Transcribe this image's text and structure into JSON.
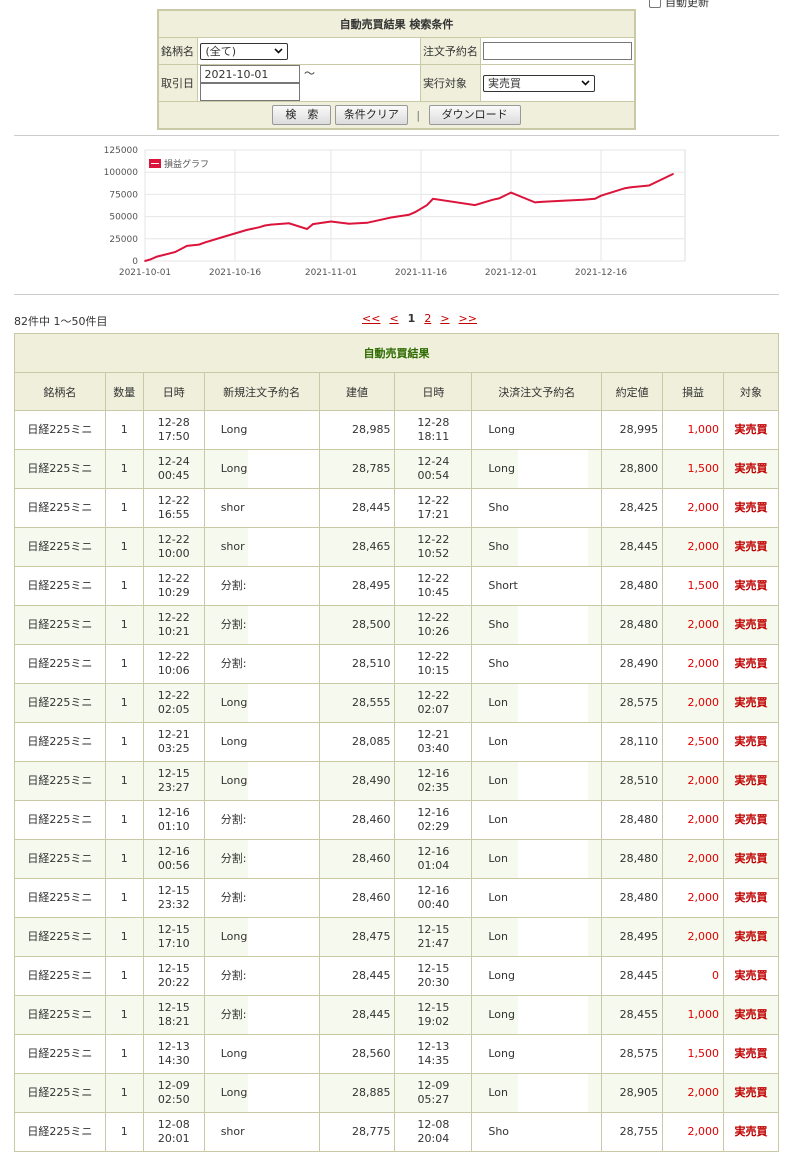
{
  "auto_refresh_label": "自動更新",
  "search": {
    "title": "自動売買結果 検索条件",
    "symbol_label": "銘柄名",
    "symbol_value": "(全て)",
    "order_name_label": "注文予約名",
    "order_name_value": "",
    "date_label": "取引日",
    "date_from": "2021-10-01",
    "date_sep": "〜",
    "date_to": "",
    "target_label": "実行対象",
    "target_value": "実売買",
    "search_button": "検　索",
    "clear_button": "条件クリア",
    "separator": "|",
    "download_button": "ダウンロード"
  },
  "chart_data": {
    "type": "line",
    "title": "",
    "legend": [
      "損益グラフ"
    ],
    "legend_position": "top-left",
    "grid": true,
    "xlabel": "",
    "ylabel": "",
    "ylim": [
      0,
      125000
    ],
    "yticks": [
      "125000",
      "100000",
      "75000",
      "50000",
      "25000",
      "0"
    ],
    "xticks": [
      "2021-10-01",
      "2021-10-16",
      "2021-11-01",
      "2021-11-16",
      "2021-12-01",
      "2021-12-16"
    ],
    "x": [
      "2021-10-01",
      "2021-10-02",
      "2021-10-03",
      "2021-10-06",
      "2021-10-08",
      "2021-10-10",
      "2021-10-11",
      "2021-10-14",
      "2021-10-18",
      "2021-10-20",
      "2021-10-21",
      "2021-10-22",
      "2021-10-25",
      "2021-10-28",
      "2021-10-29",
      "2021-10-31",
      "2021-11-01",
      "2021-11-04",
      "2021-11-07",
      "2021-11-09",
      "2021-11-11",
      "2021-11-14",
      "2021-11-15",
      "2021-11-17",
      "2021-11-18",
      "2021-11-25",
      "2021-11-28",
      "2021-11-29",
      "2021-12-01",
      "2021-12-05",
      "2021-12-06",
      "2021-12-10",
      "2021-12-13",
      "2021-12-15",
      "2021-12-16",
      "2021-12-20",
      "2021-12-21",
      "2021-12-24",
      "2021-12-28"
    ],
    "series": [
      {
        "name": "損益グラフ",
        "color": "#dc143c",
        "values": [
          0,
          2000,
          5000,
          10000,
          17000,
          18500,
          21000,
          27000,
          35000,
          38000,
          40000,
          41000,
          42500,
          36000,
          41500,
          43500,
          44500,
          42000,
          43000,
          46000,
          49000,
          52000,
          55000,
          63000,
          70000,
          63000,
          69000,
          70500,
          77000,
          66000,
          66500,
          68000,
          69000,
          70000,
          73500,
          82000,
          83000,
          85000,
          98000
        ]
      }
    ]
  },
  "count_text": "82件中 1〜50件目",
  "pager": {
    "first": "<<",
    "prev": "<",
    "p1": "1",
    "p2": "2",
    "next": ">",
    "last": ">>"
  },
  "results": {
    "title": "自動売買結果",
    "headers": [
      "銘柄名",
      "数量",
      "日時",
      "新規注文予約名",
      "建値",
      "日時",
      "決済注文予約名",
      "約定値",
      "損益",
      "対象"
    ],
    "rows": [
      {
        "sym": "日経225ミニ",
        "qty": "1",
        "d1": "12-28",
        "t1": "17:50",
        "n1": "Long",
        "p1": "28,985",
        "d2": "12-28",
        "t2": "18:11",
        "n2": "Long",
        "p2": "28,995",
        "pl": "1,000",
        "tg": "実売買"
      },
      {
        "sym": "日経225ミニ",
        "qty": "1",
        "d1": "12-24",
        "t1": "00:45",
        "n1": "Long",
        "p1": "28,785",
        "d2": "12-24",
        "t2": "00:54",
        "n2": "Long",
        "p2": "28,800",
        "pl": "1,500",
        "tg": "実売買"
      },
      {
        "sym": "日経225ミニ",
        "qty": "1",
        "d1": "12-22",
        "t1": "16:55",
        "n1": "shor",
        "p1": "28,445",
        "d2": "12-22",
        "t2": "17:21",
        "n2": "Sho",
        "p2": "28,425",
        "pl": "2,000",
        "tg": "実売買"
      },
      {
        "sym": "日経225ミニ",
        "qty": "1",
        "d1": "12-22",
        "t1": "10:00",
        "n1": "shor",
        "p1": "28,465",
        "d2": "12-22",
        "t2": "10:52",
        "n2": "Sho",
        "p2": "28,445",
        "pl": "2,000",
        "tg": "実売買"
      },
      {
        "sym": "日経225ミニ",
        "qty": "1",
        "d1": "12-22",
        "t1": "10:29",
        "n1": "分割:",
        "p1": "28,495",
        "d2": "12-22",
        "t2": "10:45",
        "n2": "Short",
        "p2": "28,480",
        "pl": "1,500",
        "tg": "実売買"
      },
      {
        "sym": "日経225ミニ",
        "qty": "1",
        "d1": "12-22",
        "t1": "10:21",
        "n1": "分割:",
        "p1": "28,500",
        "d2": "12-22",
        "t2": "10:26",
        "n2": "Sho",
        "p2": "28,480",
        "pl": "2,000",
        "tg": "実売買"
      },
      {
        "sym": "日経225ミニ",
        "qty": "1",
        "d1": "12-22",
        "t1": "10:06",
        "n1": "分割:",
        "p1": "28,510",
        "d2": "12-22",
        "t2": "10:15",
        "n2": "Sho",
        "p2": "28,490",
        "pl": "2,000",
        "tg": "実売買"
      },
      {
        "sym": "日経225ミニ",
        "qty": "1",
        "d1": "12-22",
        "t1": "02:05",
        "n1": "Long",
        "p1": "28,555",
        "d2": "12-22",
        "t2": "02:07",
        "n2": "Lon",
        "p2": "28,575",
        "pl": "2,000",
        "tg": "実売買"
      },
      {
        "sym": "日経225ミニ",
        "qty": "1",
        "d1": "12-21",
        "t1": "03:25",
        "n1": "Long",
        "p1": "28,085",
        "d2": "12-21",
        "t2": "03:40",
        "n2": "Lon",
        "p2": "28,110",
        "pl": "2,500",
        "tg": "実売買"
      },
      {
        "sym": "日経225ミニ",
        "qty": "1",
        "d1": "12-15",
        "t1": "23:27",
        "n1": "Long",
        "p1": "28,490",
        "d2": "12-16",
        "t2": "02:35",
        "n2": "Lon",
        "p2": "28,510",
        "pl": "2,000",
        "tg": "実売買"
      },
      {
        "sym": "日経225ミニ",
        "qty": "1",
        "d1": "12-16",
        "t1": "01:10",
        "n1": "分割:",
        "p1": "28,460",
        "d2": "12-16",
        "t2": "02:29",
        "n2": "Lon",
        "p2": "28,480",
        "pl": "2,000",
        "tg": "実売買"
      },
      {
        "sym": "日経225ミニ",
        "qty": "1",
        "d1": "12-16",
        "t1": "00:56",
        "n1": "分割:",
        "p1": "28,460",
        "d2": "12-16",
        "t2": "01:04",
        "n2": "Lon",
        "p2": "28,480",
        "pl": "2,000",
        "tg": "実売買"
      },
      {
        "sym": "日経225ミニ",
        "qty": "1",
        "d1": "12-15",
        "t1": "23:32",
        "n1": "分割:",
        "p1": "28,460",
        "d2": "12-16",
        "t2": "00:40",
        "n2": "Lon",
        "p2": "28,480",
        "pl": "2,000",
        "tg": "実売買"
      },
      {
        "sym": "日経225ミニ",
        "qty": "1",
        "d1": "12-15",
        "t1": "17:10",
        "n1": "Long",
        "p1": "28,475",
        "d2": "12-15",
        "t2": "21:47",
        "n2": "Lon",
        "p2": "28,495",
        "pl": "2,000",
        "tg": "実売買"
      },
      {
        "sym": "日経225ミニ",
        "qty": "1",
        "d1": "12-15",
        "t1": "20:22",
        "n1": "分割:",
        "p1": "28,445",
        "d2": "12-15",
        "t2": "20:30",
        "n2": "Long",
        "p2": "28,445",
        "pl": "0",
        "tg": "実売買"
      },
      {
        "sym": "日経225ミニ",
        "qty": "1",
        "d1": "12-15",
        "t1": "18:21",
        "n1": "分割:",
        "p1": "28,445",
        "d2": "12-15",
        "t2": "19:02",
        "n2": "Long",
        "p2": "28,455",
        "pl": "1,000",
        "tg": "実売買"
      },
      {
        "sym": "日経225ミニ",
        "qty": "1",
        "d1": "12-13",
        "t1": "14:30",
        "n1": "Long",
        "p1": "28,560",
        "d2": "12-13",
        "t2": "14:35",
        "n2": "Long",
        "p2": "28,575",
        "pl": "1,500",
        "tg": "実売買"
      },
      {
        "sym": "日経225ミニ",
        "qty": "1",
        "d1": "12-09",
        "t1": "02:50",
        "n1": "Long",
        "p1": "28,885",
        "d2": "12-09",
        "t2": "05:27",
        "n2": "Lon",
        "p2": "28,905",
        "pl": "2,000",
        "tg": "実売買"
      },
      {
        "sym": "日経225ミニ",
        "qty": "1",
        "d1": "12-08",
        "t1": "20:01",
        "n1": "shor",
        "p1": "28,775",
        "d2": "12-08",
        "t2": "20:04",
        "n2": "Sho",
        "p2": "28,755",
        "pl": "2,000",
        "tg": "実売買"
      }
    ]
  }
}
